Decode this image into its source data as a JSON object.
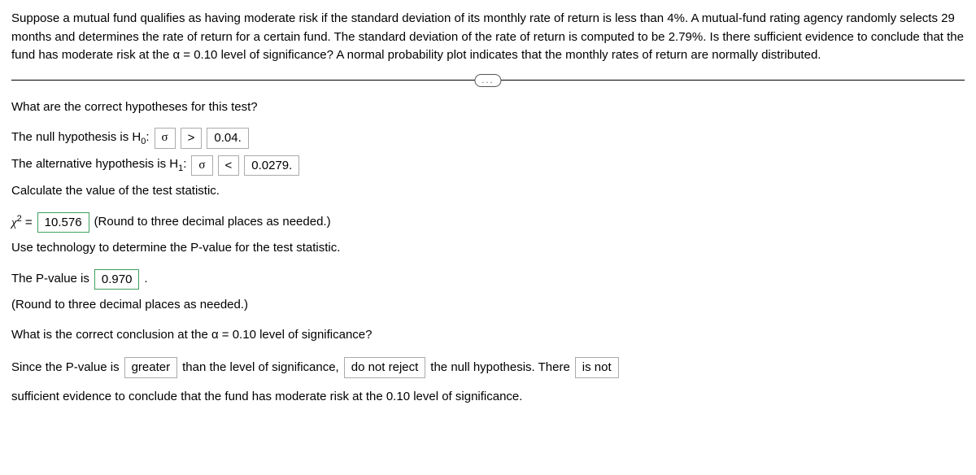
{
  "problem": "Suppose a mutual fund qualifies as having moderate risk if the standard deviation of its monthly rate of return is less than 4%. A mutual-fund rating agency randomly selects 29 months and determines the rate of return for a certain fund. The standard deviation of the rate of return is computed to be 2.79%. Is there sufficient evidence to conclude that the fund has moderate risk at the α = 0.10 level of significance? A normal probability plot indicates that the monthly rates of return are normally distributed.",
  "divider_label": "...",
  "q1": "What are the correct hypotheses for this test?",
  "null_prefix": "The null hypothesis is H",
  "null_sub": "0",
  "colon": ":",
  "h0_param": "σ",
  "h0_op": ">",
  "h0_val": "0.04.",
  "alt_prefix": "The alternative hypothesis is H",
  "alt_sub": "1",
  "h1_param": "σ",
  "h1_op": "<",
  "h1_val": "0.0279.",
  "q2": "Calculate the value of the test statistic.",
  "chi_label_pre": "χ",
  "chi_sup": "2",
  "chi_eq": " = ",
  "chi_val": "10.576",
  "chi_note": " (Round to three decimal places as needed.)",
  "q3": "Use technology to determine the P-value for the test statistic.",
  "pval_prefix": "The P-value is ",
  "pval": "0.970",
  "pval_suffix": ".",
  "pval_note": "(Round to three decimal places as needed.)",
  "q4": "What is the correct conclusion at the α = 0.10 level of significance?",
  "concl_1": "Since the P-value is ",
  "concl_sel1": "greater",
  "concl_2": " than the level of significance, ",
  "concl_sel2": "do not reject",
  "concl_3": " the null hypothesis. There ",
  "concl_sel3": "is not",
  "concl_4": " sufficient evidence to conclude that the fund has moderate risk at the 0.10 level of significance."
}
